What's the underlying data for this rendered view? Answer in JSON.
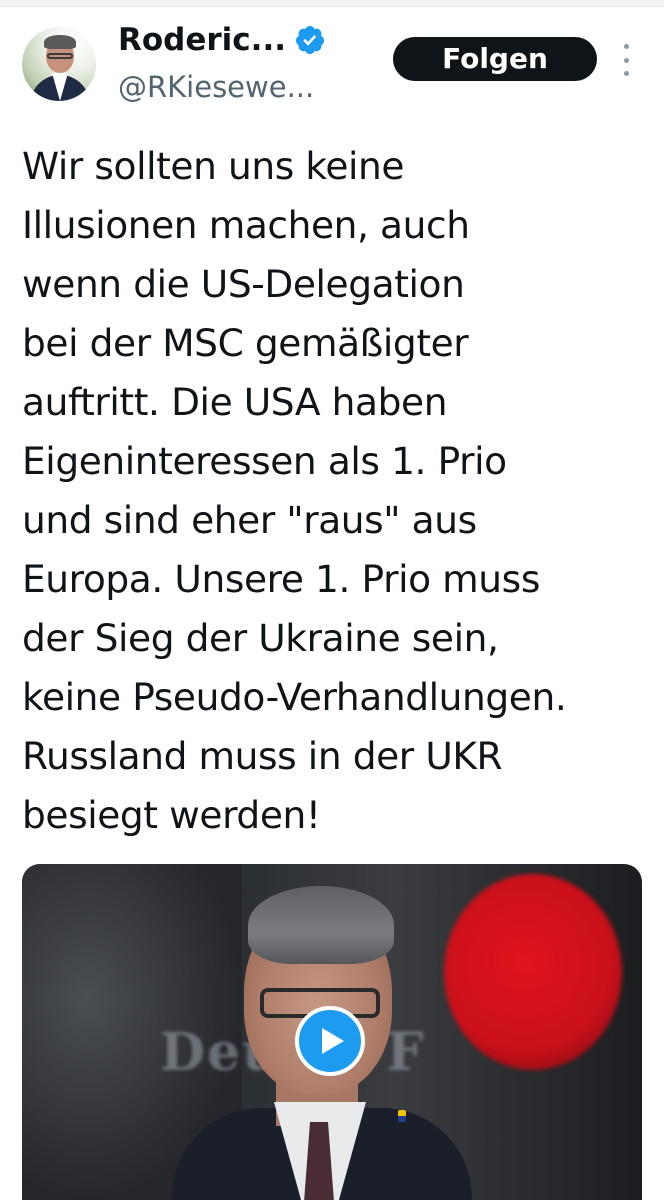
{
  "tweet": {
    "author": {
      "display_name": "Roderic...",
      "handle": "@RKiesewe...",
      "verified": true,
      "verified_color": "#1d9bf0"
    },
    "follow_button_label": "Folgen",
    "more_icon": "more-vertical-icon",
    "text_lines": [
      "Wir sollten uns keine",
      "Illusionen machen, auch",
      "wenn die US-Delegation",
      "bei der MSC gemäßigter",
      "auftritt. Die USA haben",
      "Eigeninteressen als 1. Prio",
      "und sind eher \"raus\" aus",
      "Europa. Unsere 1. Prio muss",
      "der Sieg der Ukraine sein,",
      "keine Pseudo-Verhandlungen.",
      "Russland muss in der UKR",
      "besiegt werden!"
    ],
    "media": {
      "type": "video",
      "background_text": "Deu     er F",
      "play_icon": "play-icon",
      "play_color": "#1d9bf0"
    }
  },
  "colors": {
    "text_primary": "#0f1419",
    "text_secondary": "#536471",
    "button_bg": "#0f1419",
    "button_text": "#ffffff"
  }
}
